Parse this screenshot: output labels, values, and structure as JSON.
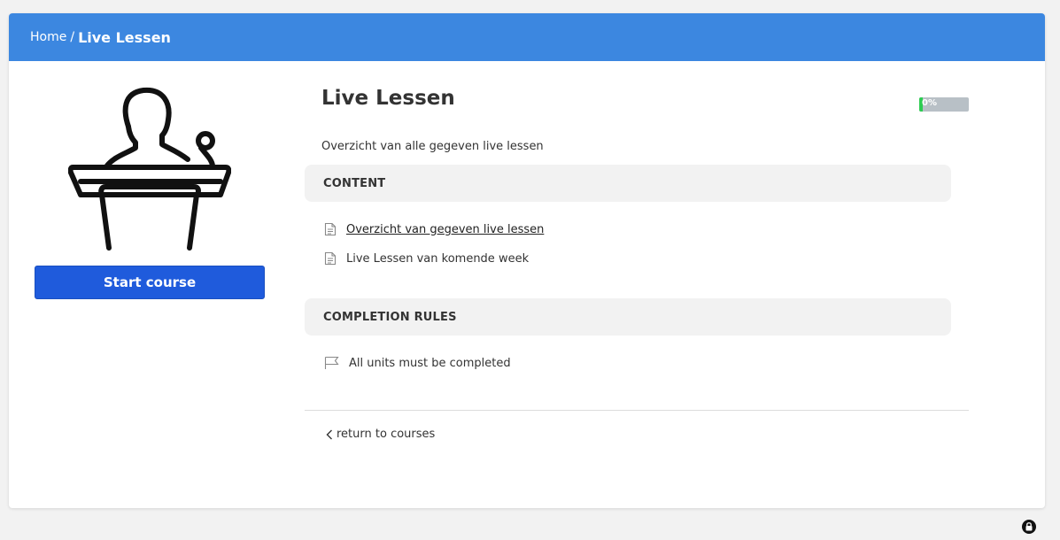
{
  "breadcrumb": {
    "home": "Home",
    "separator": "/",
    "current": "Live Lessen"
  },
  "course": {
    "icon": "podium-speaker-icon",
    "start_label": "Start course",
    "title": "Live Lessen",
    "description": "Overzicht van alle gegeven live lessen",
    "progress": {
      "value_percent": 0,
      "label": "0%",
      "track_color": "#b8c0c6",
      "fill_color": "#2ecc52"
    }
  },
  "content": {
    "heading": "CONTENT",
    "units": [
      {
        "label": "Overzicht van gegeven live lessen",
        "icon": "document-icon",
        "linked": true
      },
      {
        "label": "Live Lessen van komende week",
        "icon": "document-icon",
        "linked": false
      }
    ]
  },
  "completion": {
    "heading": "COMPLETION RULES",
    "rules": [
      {
        "label": "All units must be completed",
        "icon": "flag-icon"
      }
    ]
  },
  "footer": {
    "return_label": "return to courses"
  },
  "colors": {
    "header": "#3c87e0",
    "button": "#1f5bdc",
    "page_bg": "#f2f2f2"
  }
}
